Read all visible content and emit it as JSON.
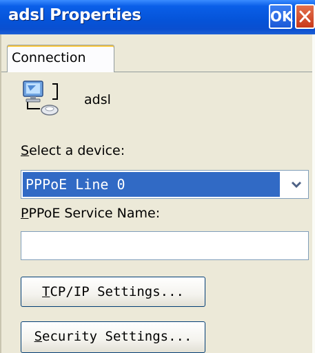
{
  "window": {
    "title": "adsl Properties",
    "ok_label": "OK"
  },
  "tabs": [
    {
      "label": "Connection"
    }
  ],
  "connection": {
    "name": "adsl",
    "icon": "network-connection-icon"
  },
  "device": {
    "label_first": "S",
    "label_rest": "elect a device:",
    "selected_value": "PPPoE Line 0"
  },
  "service": {
    "label_first": "P",
    "label_rest": "PPoE Service Name:",
    "value": ""
  },
  "buttons": {
    "tcpip_first": "T",
    "tcpip_rest": "CP/IP Settings...",
    "security_first": "S",
    "security_rest": "ecurity Settings..."
  },
  "colors": {
    "titlebar": "#0553d8",
    "selection": "#316ac5",
    "dialog_bg": "#ece9d8",
    "close_button": "#c8391a"
  }
}
